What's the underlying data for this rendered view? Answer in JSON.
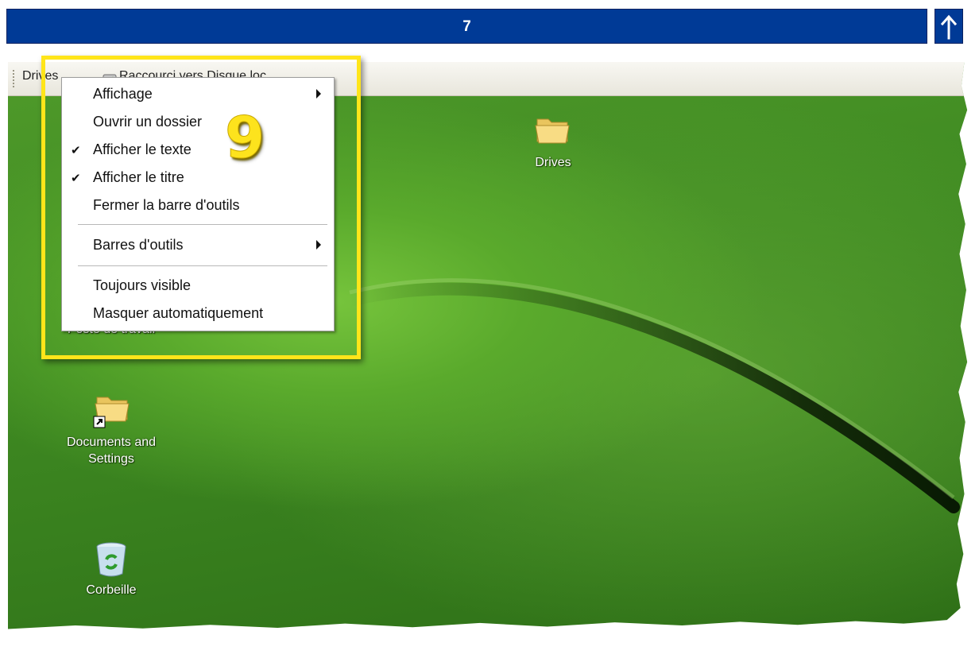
{
  "header": {
    "step_number": "7",
    "scroll_top_icon": "up-arrow-icon"
  },
  "toolbar": {
    "label": "Drives",
    "shortcut_label": "Raccourci vers Disque loc..."
  },
  "context_menu": {
    "items": [
      {
        "label": "Affichage",
        "checked": false,
        "submenu": true
      },
      {
        "label": "Ouvrir un dossier",
        "checked": false,
        "submenu": false
      },
      {
        "label": "Afficher le texte",
        "checked": true,
        "submenu": false
      },
      {
        "label": "Afficher le titre",
        "checked": true,
        "submenu": false
      },
      {
        "label": "Fermer la barre d'outils",
        "checked": false,
        "submenu": false
      },
      {
        "label": "Barres d'outils",
        "checked": false,
        "submenu": true
      },
      {
        "label": "Toujours visible",
        "checked": false,
        "submenu": false
      },
      {
        "label": "Masquer automatiquement",
        "checked": false,
        "submenu": false
      }
    ]
  },
  "callout": {
    "number": "9",
    "highlight_color": "#ffe51a"
  },
  "desktop": {
    "icons": [
      {
        "label_lines": [
          "Drives"
        ],
        "icon": "folder-icon"
      },
      {
        "label_lines": [
          "Poste de travail"
        ],
        "icon": "computer-icon"
      },
      {
        "label_lines": [
          "Documents and",
          "Settings"
        ],
        "icon": "folder-shortcut-icon"
      },
      {
        "label_lines": [
          "Corbeille"
        ],
        "icon": "recycle-bin-icon"
      }
    ]
  },
  "colors": {
    "title_bar": "#003a96",
    "desktop_green": "#4f9a2a"
  }
}
